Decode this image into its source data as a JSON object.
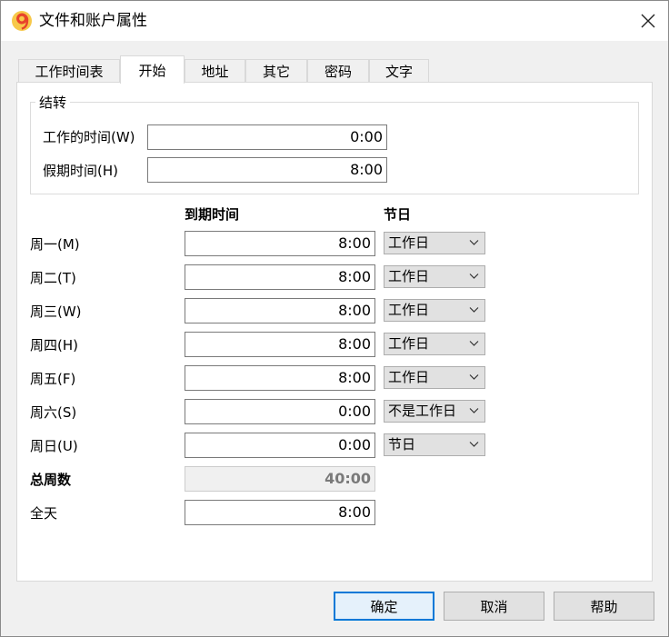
{
  "window": {
    "title": "文件和账户属性"
  },
  "tabs": [
    {
      "label": "工作时间表",
      "active": false
    },
    {
      "label": "开始",
      "active": true
    },
    {
      "label": "地址",
      "active": false
    },
    {
      "label": "其它",
      "active": false
    },
    {
      "label": "密码",
      "active": false
    },
    {
      "label": "文字",
      "active": false
    }
  ],
  "carryover": {
    "legend": "结转",
    "work_time_label": "工作的时间(W)",
    "work_time_value": "0:00",
    "holiday_time_label": "假期时间(H)",
    "holiday_time_value": "8:00"
  },
  "schedule": {
    "col_due_time": "到期时间",
    "col_holiday": "节日",
    "days": [
      {
        "label": "周一(M)",
        "time": "8:00",
        "type": "工作日"
      },
      {
        "label": "周二(T)",
        "time": "8:00",
        "type": "工作日"
      },
      {
        "label": "周三(W)",
        "time": "8:00",
        "type": "工作日"
      },
      {
        "label": "周四(H)",
        "time": "8:00",
        "type": "工作日"
      },
      {
        "label": "周五(F)",
        "time": "8:00",
        "type": "工作日"
      },
      {
        "label": "周六(S)",
        "time": "0:00",
        "type": "不是工作日"
      },
      {
        "label": "周日(U)",
        "time": "0:00",
        "type": "节日"
      }
    ],
    "total_label": "总周数",
    "total_value": "40:00",
    "fullday_label": "全天",
    "fullday_value": "8:00"
  },
  "buttons": {
    "ok": "确定",
    "cancel": "取消",
    "help": "帮助"
  },
  "colors": {
    "accent": "#0078d7",
    "app_icon": "#e8432b"
  }
}
